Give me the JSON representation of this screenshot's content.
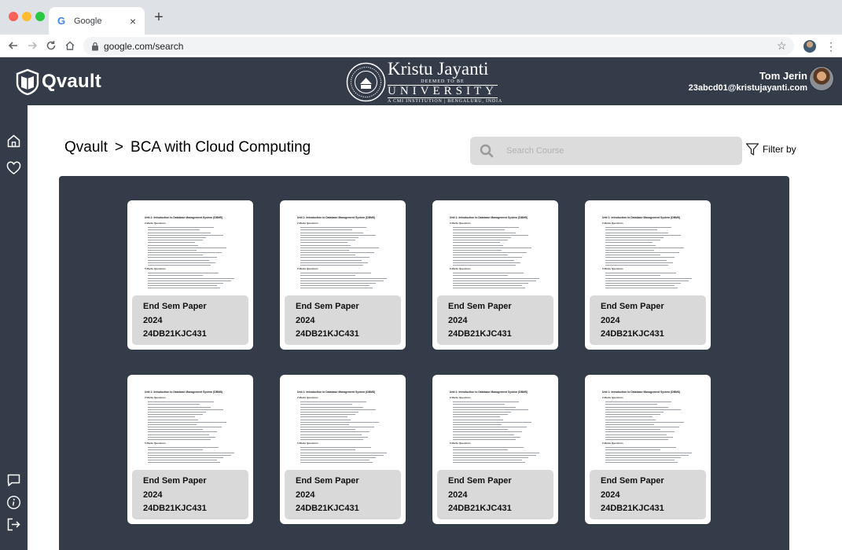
{
  "browser": {
    "tab_title": "Google",
    "tab_favicon": "G",
    "url": "google.com/search",
    "icons": [
      "back-icon",
      "forward-icon",
      "reload-icon",
      "home-icon",
      "lock-icon",
      "star-icon",
      "profile-avatar",
      "menu-kebab-icon"
    ]
  },
  "header": {
    "app_name": "Qvault",
    "institution": {
      "name": "Kristu Jayanti",
      "deemed": "DEEMED TO BE",
      "university": "UNIVERSITY",
      "subtitle": "A CMI INSTITUTION | BENGALURU, INDIA"
    },
    "user": {
      "name": "Tom Jerin",
      "email": "23abcd01@kristujayanti.com"
    }
  },
  "sidebar": {
    "top_icons": [
      "home-icon",
      "heart-icon"
    ],
    "bottom_icons": [
      "chat-icon",
      "info-icon",
      "logout-icon"
    ]
  },
  "breadcrumb": {
    "root": "Qvault",
    "separator": ">",
    "current": "BCA with Cloud Computing"
  },
  "search": {
    "placeholder": "Search Course"
  },
  "filter": {
    "label": "Filter by"
  },
  "papers": [
    {
      "type": "End Sem Paper",
      "year": "2024",
      "code": "24DB21KJC431"
    },
    {
      "type": "End Sem Paper",
      "year": "2024",
      "code": "24DB21KJC431"
    },
    {
      "type": "End Sem Paper",
      "year": "2024",
      "code": "24DB21KJC431"
    },
    {
      "type": "End Sem Paper",
      "year": "2024",
      "code": "24DB21KJC431"
    },
    {
      "type": "End Sem Paper",
      "year": "2024",
      "code": "24DB21KJC431"
    },
    {
      "type": "End Sem Paper",
      "year": "2024",
      "code": "24DB21KJC431"
    },
    {
      "type": "End Sem Paper",
      "year": "2024",
      "code": "24DB21KJC431"
    },
    {
      "type": "End Sem Paper",
      "year": "2024",
      "code": "24DB21KJC431"
    }
  ],
  "paper_preview": {
    "title": "Unit 1: Introduction to Database Management System (DBMS)",
    "section1": "2 Marks Questions",
    "section2": "5 Marks Questions"
  },
  "colors": {
    "header_bg": "#343c4a",
    "panel_bg": "#343c4a",
    "search_bg": "#dcdcdc",
    "overlay_bg": "#d6d6d6"
  }
}
